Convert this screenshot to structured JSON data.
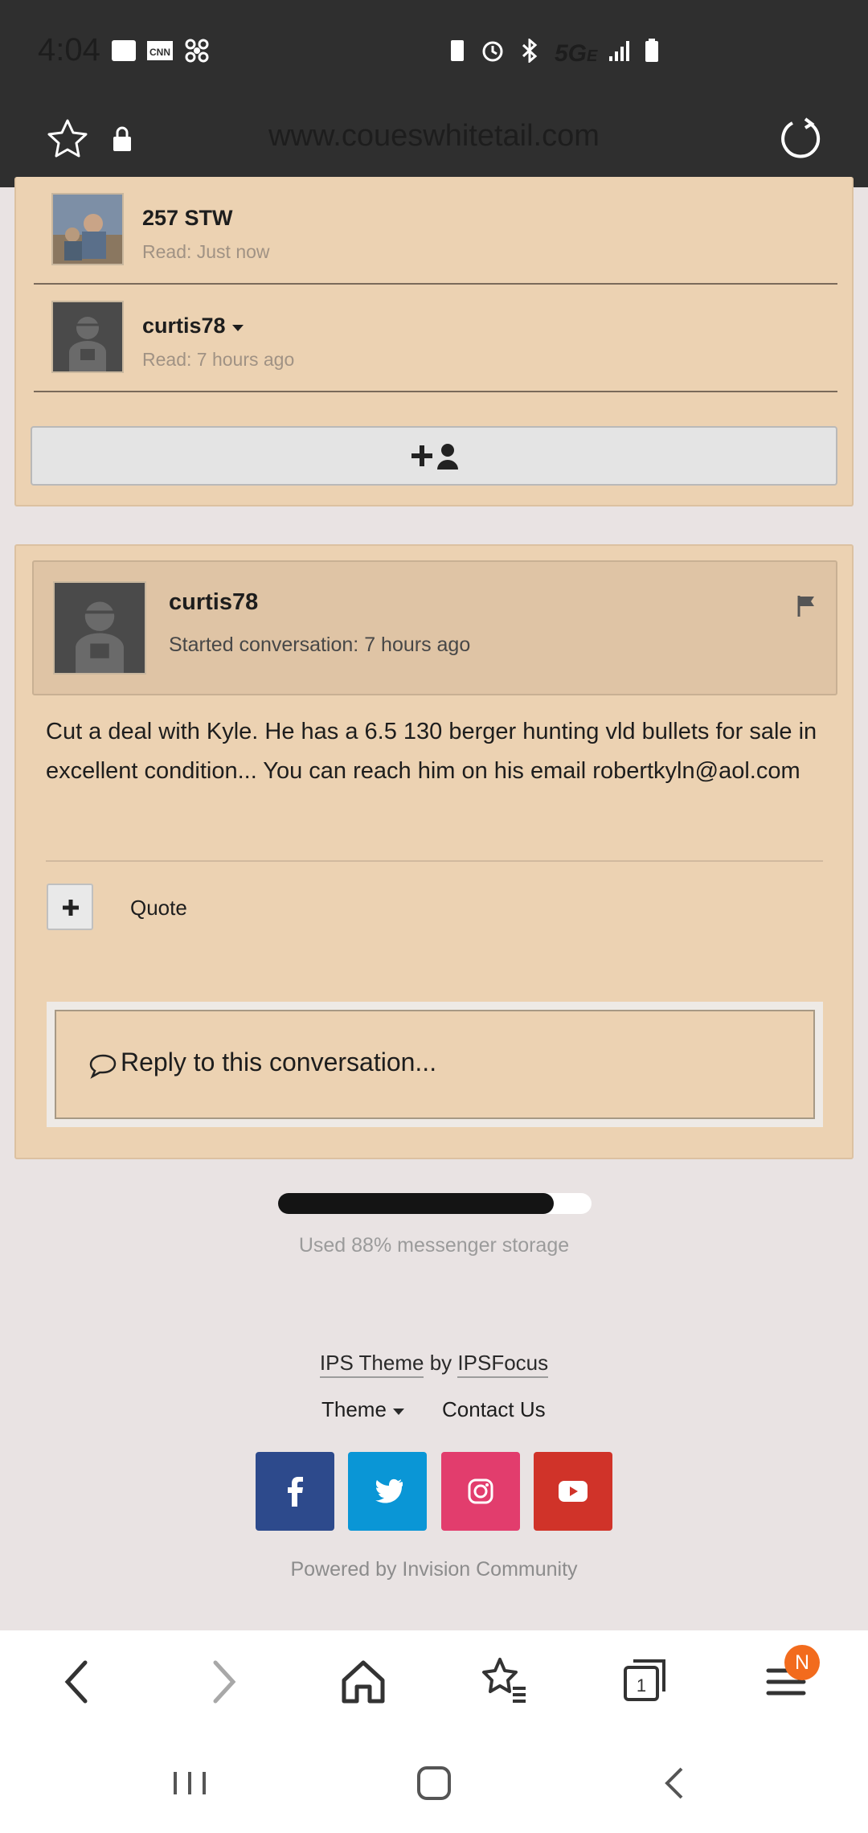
{
  "status_bar": {
    "time": "4:04",
    "network": "5G",
    "network_sub": "E"
  },
  "browser": {
    "url": "www.coueswhitetail.com"
  },
  "participants": [
    {
      "name": "257 STW",
      "read": "Read: Just now",
      "avatar": "photo-avatar"
    },
    {
      "name": "curtis78",
      "read": "Read: 7 hours ago",
      "avatar": "default-avatar",
      "has_dropdown": true
    }
  ],
  "conversation": {
    "author": "curtis78",
    "meta": "Started conversation: 7 hours ago",
    "message": "Cut a deal with Kyle. He has a 6.5 130 berger hunting vld bullets for sale in excellent condition... You can reach him on his email robertkyln@aol.com",
    "quote_label": "Quote",
    "reply_placeholder": "Reply to this conversation..."
  },
  "storage": {
    "used_fraction": 0.88,
    "label": "Used 88% messenger storage"
  },
  "footer": {
    "ips_theme": "IPS Theme",
    "by": "by",
    "ipsfocus": "IPSFocus",
    "theme": "Theme",
    "contact": "Contact Us",
    "powered_by": "Powered by Invision Community",
    "social": [
      {
        "name": "facebook",
        "glyph": "f",
        "color": "#2d4a8c"
      },
      {
        "name": "twitter",
        "glyph": "t",
        "color": "#0a96d6"
      },
      {
        "name": "instagram",
        "glyph": "ig",
        "color": "#e23d6d"
      },
      {
        "name": "youtube",
        "glyph": "yt",
        "color": "#d03329"
      }
    ]
  },
  "browser_nav": {
    "badge": "N"
  }
}
